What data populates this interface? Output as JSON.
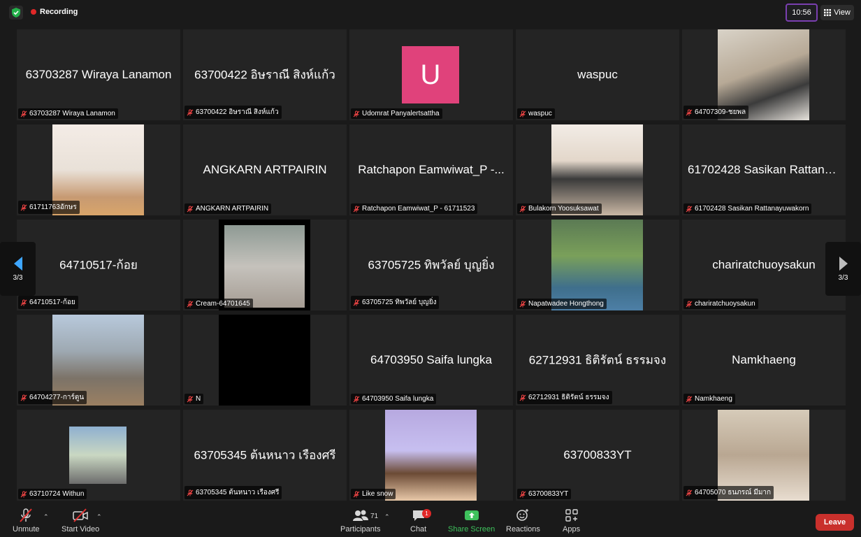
{
  "topbar": {
    "recording_label": "Recording",
    "clock": "10:56",
    "view_label": "View"
  },
  "tiles": [
    {
      "display": "63703287 Wiraya Lanamon",
      "label": "63703287 Wiraya Lanamon"
    },
    {
      "display": "63700422 อิษราณี สิงห์แก้ว",
      "label": "63700422 อิษราณี สิงห์แก้ว"
    },
    {
      "avatar": "U",
      "label": "Udomrat Panyalertsattha"
    },
    {
      "display": "waspuc",
      "label": "waspuc"
    },
    {
      "label": "64707309-ชยพล"
    },
    {
      "label": "61711763อักษร"
    },
    {
      "display": "ANGKARN ARTPAIRIN",
      "label": "ANGKARN ARTPAIRIN"
    },
    {
      "display": "Ratchapon Eamwiwat_P -...",
      "label": "Ratchapon Eamwiwat_P - 61711523"
    },
    {
      "label": "Bulakorn Yoosuksawat"
    },
    {
      "display": "61702428 Sasikan Rattana...",
      "label": "61702428 Sasikan Rattanayuwakorn"
    },
    {
      "display": "64710517-ก้อย",
      "label": "64710517-ก้อย"
    },
    {
      "label": "Cream-64701645"
    },
    {
      "display": "63705725 ทิพวัลย์ บุญยิ่ง",
      "label": "63705725 ทิพวัลย์ บุญยิ่ง"
    },
    {
      "label": "Napatwadee Hongthong"
    },
    {
      "display": "chariratchuoysakun",
      "label": "chariratchuoysakun"
    },
    {
      "label": "64704277-การ์ตูน"
    },
    {
      "label": "N"
    },
    {
      "display": "64703950 Saifa lungka",
      "label": "64703950 Saifa lungka"
    },
    {
      "display": "62712931 ธิติรัตน์ ธรรมจง",
      "label": "62712931 ธิติรัตน์ ธรรมจง"
    },
    {
      "display": "Namkhaeng",
      "label": "Namkhaeng"
    },
    {
      "label": "63710724 Withun"
    },
    {
      "display": "63705345 ต้นหนาว เรืองศรี",
      "label": "63705345 ต้นหนาว เรืองศรี"
    },
    {
      "label": "Like snow"
    },
    {
      "display": "63700833YT",
      "label": "63700833YT"
    },
    {
      "label": "64705070 ธนภรณ์ มีมาก"
    }
  ],
  "nav": {
    "left_page": "3/3",
    "right_page": "3/3"
  },
  "toolbar": {
    "unmute": "Unmute",
    "start_video": "Start Video",
    "participants": "Participants",
    "participant_count": "71",
    "chat": "Chat",
    "chat_badge": "1",
    "share_screen": "Share Screen",
    "reactions": "Reactions",
    "apps": "Apps",
    "leave": "Leave"
  },
  "colors": {
    "share_green": "#3ec15c",
    "leave_red": "#c9302c",
    "avatar_pink": "#e0427b"
  }
}
